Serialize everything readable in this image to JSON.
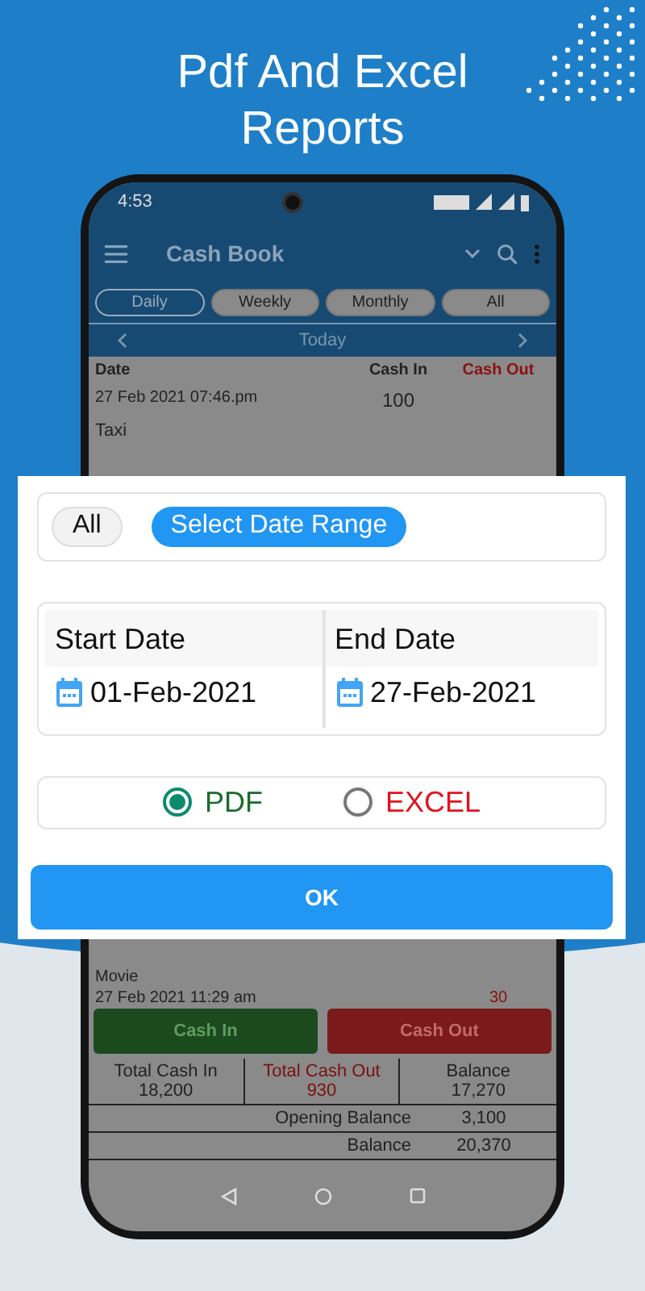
{
  "headline": "Pdf And Excel Reports",
  "status_bar": {
    "time": "4:53"
  },
  "app_bar": {
    "title": "Cash Book"
  },
  "period_tabs": [
    {
      "label": "Daily",
      "selected": true
    },
    {
      "label": "Weekly",
      "selected": false
    },
    {
      "label": "Monthly",
      "selected": false
    },
    {
      "label": "All",
      "selected": false
    }
  ],
  "date_nav": {
    "label": "Today"
  },
  "table": {
    "columns": [
      "Date",
      "Cash In",
      "Cash Out"
    ],
    "rows": [
      {
        "date": "27 Feb 2021 07:46.pm",
        "note": "Taxi",
        "cash_in": "100"
      }
    ]
  },
  "lower_entries": [
    {
      "note": "Movie"
    },
    {
      "date": "27 Feb 2021 11:29 am",
      "cash_out": "30"
    }
  ],
  "actions": [
    {
      "label": "Cash In",
      "kind": "in"
    },
    {
      "label": "Cash Out",
      "kind": "out"
    }
  ],
  "totals": [
    {
      "label": "Total Cash In",
      "value": "18,200",
      "kind": "in"
    },
    {
      "label": "Total Cash Out",
      "value": "930",
      "kind": "out"
    },
    {
      "label": "Balance",
      "value": "17,270",
      "kind": "plain"
    }
  ],
  "summary": [
    {
      "label": "Opening Balance",
      "value": "3,100"
    },
    {
      "label": "Balance",
      "value": "20,370"
    }
  ],
  "dialog": {
    "range_options": [
      {
        "label": "All",
        "selected": false
      },
      {
        "label": "Select Date Range",
        "selected": true
      }
    ],
    "dates": [
      {
        "label": "Start Date",
        "value": "01-Feb-2021"
      },
      {
        "label": "End Date",
        "value": "27-Feb-2021"
      }
    ],
    "formats": [
      {
        "label": "PDF",
        "selected": true,
        "kind": "pdf"
      },
      {
        "label": "EXCEL",
        "selected": false,
        "kind": "excel"
      }
    ],
    "ok": "OK"
  }
}
